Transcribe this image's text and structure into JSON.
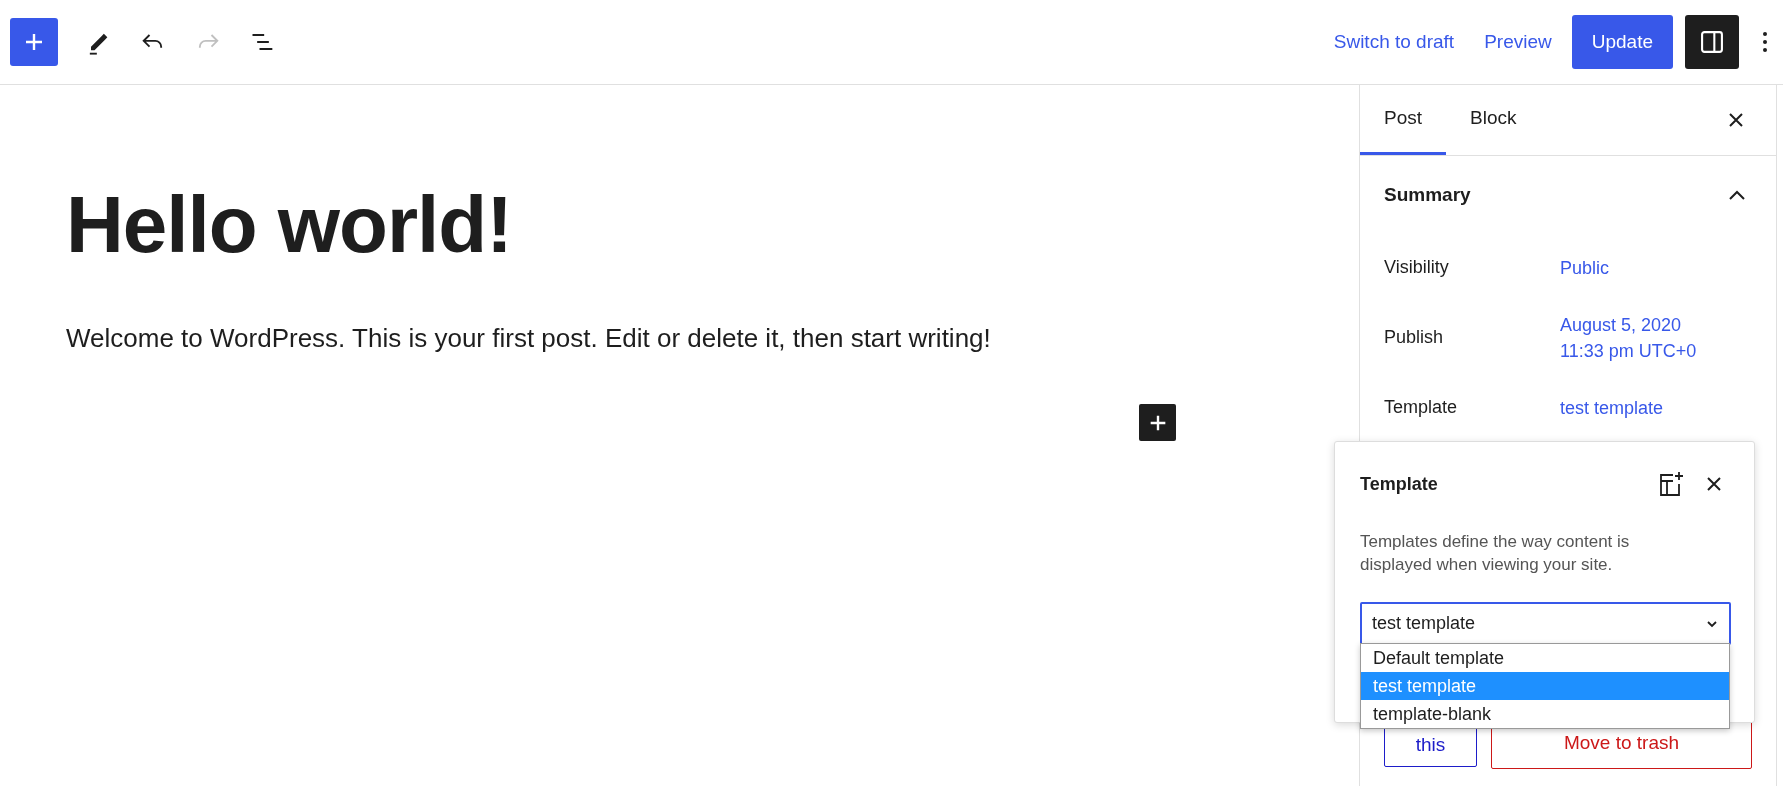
{
  "toolbar": {
    "tools": [
      {
        "kind": "inserter",
        "disabled": false
      },
      {
        "kind": "pencil",
        "disabled": false
      },
      {
        "kind": "undo",
        "disabled": false
      },
      {
        "kind": "redo",
        "disabled": true
      },
      {
        "kind": "list_view",
        "disabled": false
      }
    ],
    "links": [
      "Switch to draft",
      "Preview"
    ],
    "primary_button": "Update",
    "sidebar_toggle": {
      "pressed": true
    }
  },
  "editor": {
    "title": "Hello world!",
    "paragraph": "Welcome to WordPress. This is your first post. Edit or delete it, then start writing!"
  },
  "sidebar": {
    "tabs": [
      {
        "label": "Post",
        "selected": true
      },
      {
        "label": "Block",
        "selected": false
      }
    ],
    "summary": {
      "title": "Summary",
      "expanded": true,
      "rows": [
        {
          "label": "Visibility",
          "lines": [
            "Public"
          ]
        },
        {
          "label": "Publish",
          "lines": [
            "August 5, 2020",
            "11:33 pm UTC+0"
          ]
        },
        {
          "label": "Template",
          "lines": [
            "test template"
          ]
        }
      ]
    },
    "buttons": [
      {
        "label": "this",
        "kind": "secondary"
      },
      {
        "label": "Move to trash",
        "kind": "destructive"
      }
    ]
  },
  "template_popover": {
    "title": "Template",
    "description": "Templates define the way content is displayed when viewing your site.",
    "select": {
      "value": "test template",
      "options": [
        {
          "label": "Default template",
          "selected": false
        },
        {
          "label": "test template",
          "selected": true
        },
        {
          "label": "template-blank",
          "selected": false
        }
      ]
    }
  }
}
